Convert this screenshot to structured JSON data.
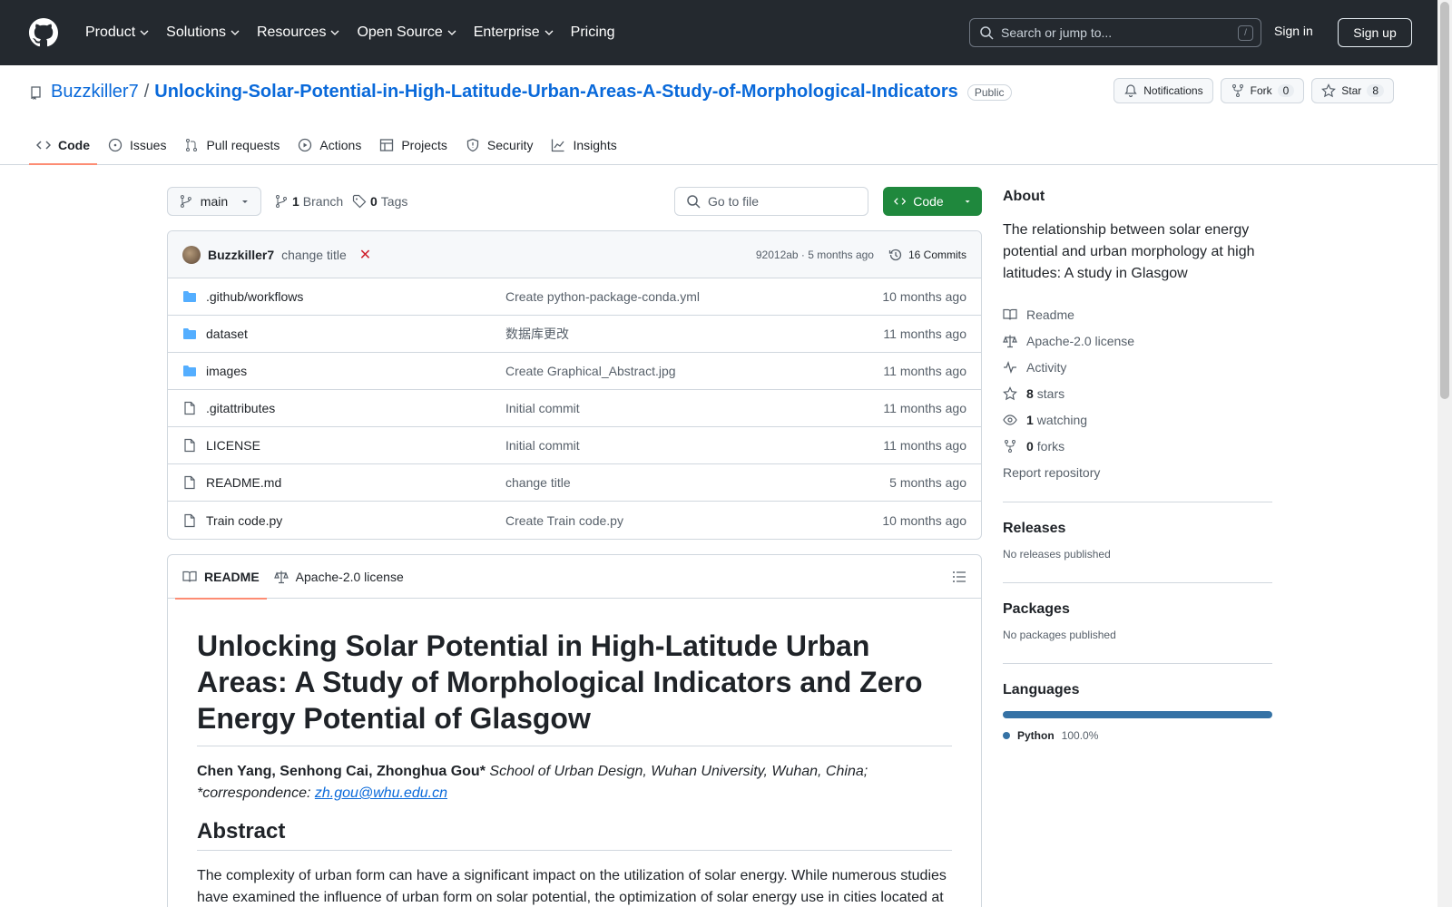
{
  "header": {
    "nav": [
      "Product",
      "Solutions",
      "Resources",
      "Open Source",
      "Enterprise",
      "Pricing"
    ],
    "search_placeholder": "Search or jump to...",
    "slash": "/",
    "signin": "Sign in",
    "signup": "Sign up"
  },
  "repo": {
    "owner": "Buzzkiller7",
    "separator": "/",
    "name": "Unlocking-Solar-Potential-in-High-Latitude-Urban-Areas-A-Study-of-Morphological-Indicators",
    "visibility": "Public",
    "notifications": "Notifications",
    "fork": "Fork",
    "fork_count": "0",
    "star": "Star",
    "star_count": "8",
    "tabs": [
      "Code",
      "Issues",
      "Pull requests",
      "Actions",
      "Projects",
      "Security",
      "Insights"
    ]
  },
  "toolbar": {
    "branch": "main",
    "branch_count": "1",
    "branch_label": "Branch",
    "tag_count": "0",
    "tag_label": "Tags",
    "goto_placeholder": "Go to file",
    "code_btn": "Code"
  },
  "commit": {
    "author": "Buzzkiller7",
    "message": "change title",
    "status": "✕",
    "hash_time": "92012ab · 5 months ago",
    "commits": "16 Commits"
  },
  "files": [
    {
      "type": "dir",
      "name": ".github/workflows",
      "message": "Create python-package-conda.yml",
      "time": "10 months ago"
    },
    {
      "type": "dir",
      "name": "dataset",
      "message": "数据库更改",
      "time": "11 months ago"
    },
    {
      "type": "dir",
      "name": "images",
      "message": "Create Graphical_Abstract.jpg",
      "time": "11 months ago"
    },
    {
      "type": "file",
      "name": ".gitattributes",
      "message": "Initial commit",
      "time": "11 months ago"
    },
    {
      "type": "file",
      "name": "LICENSE",
      "message": "Initial commit",
      "time": "11 months ago"
    },
    {
      "type": "file",
      "name": "README.md",
      "message": "change title",
      "time": "5 months ago"
    },
    {
      "type": "file",
      "name": "Train code.py",
      "message": "Create Train code.py",
      "time": "10 months ago"
    }
  ],
  "readme": {
    "tab_readme": "README",
    "tab_license": "Apache-2.0 license",
    "title": "Unlocking Solar Potential in High-Latitude Urban Areas: A Study of Morphological Indicators and Zero Energy Potential of Glasgow",
    "authors": "Chen Yang, Senhong Cai, Zhonghua Gou*",
    "affiliation": "School of Urban Design, Wuhan University, Wuhan, China; *correspondence:",
    "email": "zh.gou@whu.edu.cn",
    "abstract_heading": "Abstract",
    "abstract": "The complexity of urban form can have a significant impact on the utilization of solar energy. While numerous studies have examined the influence of urban form on solar potential, the optimization of solar energy use in cities located at"
  },
  "about": {
    "heading": "About",
    "description": "The relationship between solar energy potential and urban morphology at high latitudes: A study in Glasgow",
    "readme": "Readme",
    "license": "Apache-2.0 license",
    "activity": "Activity",
    "stars_count": "8",
    "stars_label": "stars",
    "watching_count": "1",
    "watching_label": "watching",
    "forks_count": "0",
    "forks_label": "forks",
    "report": "Report repository"
  },
  "releases": {
    "heading": "Releases",
    "text": "No releases published"
  },
  "packages": {
    "heading": "Packages",
    "text": "No packages published"
  },
  "languages": {
    "heading": "Languages",
    "name": "Python",
    "percent": "100.0%",
    "color": "#3572a5"
  },
  "colors": {
    "header_bg": "#24292f",
    "link": "#0969da",
    "green": "#1f883d",
    "accent_tab": "#fd8c73"
  }
}
